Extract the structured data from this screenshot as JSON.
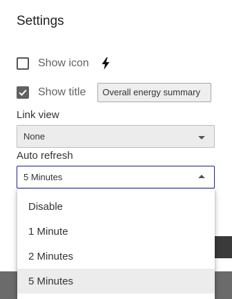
{
  "settings": {
    "title": "Settings"
  },
  "show_icon": {
    "label": "Show icon",
    "checked": false,
    "icon": "lightning-bolt-icon"
  },
  "show_title": {
    "label": "Show title",
    "checked": true,
    "value": "Overall energy summary"
  },
  "link_view": {
    "label": "Link view",
    "value": "None"
  },
  "auto_refresh": {
    "label": "Auto refresh",
    "value": "5 Minutes",
    "options": [
      "Disable",
      "1 Minute",
      "2 Minutes",
      "5 Minutes"
    ],
    "selected_index": 3
  },
  "colors": {
    "accent": "#1a1aa8",
    "field_bg": "#ececec",
    "bottom_bar": "#6b6b6b"
  }
}
